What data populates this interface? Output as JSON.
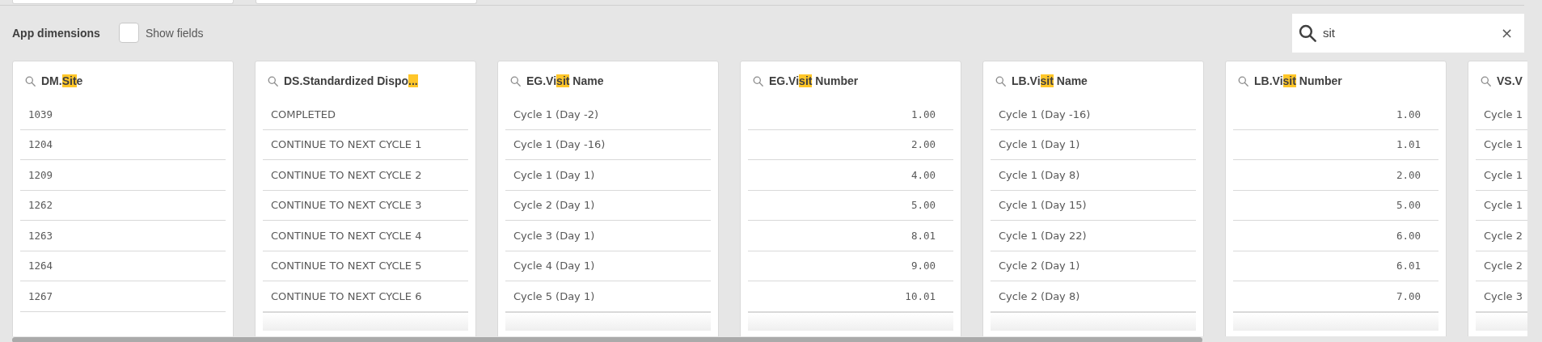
{
  "toolbar": {
    "title": "App dimensions",
    "show_fields": {
      "label": "Show fields",
      "checked": false
    },
    "search": {
      "value": "sit",
      "clear": "×"
    }
  },
  "columns": [
    {
      "title": {
        "before": "DM.",
        "match": "Sit",
        "after": "e"
      },
      "kind": "code",
      "rows": [
        "1039",
        "1204",
        "1209",
        "1262",
        "1263",
        "1264",
        "1267"
      ],
      "more": false
    },
    {
      "title": {
        "before": "DS.Standardized Dispo",
        "match": "..."
      },
      "kind": "text",
      "rows": [
        "COMPLETED",
        "CONTINUE TO NEXT CYCLE 1",
        "CONTINUE TO NEXT CYCLE 2",
        "CONTINUE TO NEXT CYCLE 3",
        "CONTINUE TO NEXT CYCLE 4",
        "CONTINUE TO NEXT CYCLE 5",
        "CONTINUE TO NEXT CYCLE 6"
      ],
      "more": true
    },
    {
      "title": {
        "before": "EG.Vi",
        "match": "sit",
        "after": " Name"
      },
      "kind": "text",
      "rows": [
        "Cycle 1 (Day -2)",
        "Cycle 1 (Day -16)",
        "Cycle 1 (Day 1)",
        "Cycle 2 (Day 1)",
        "Cycle 3 (Day 1)",
        "Cycle 4 (Day 1)",
        "Cycle 5 (Day 1)"
      ],
      "more": true
    },
    {
      "title": {
        "before": "EG.Vi",
        "match": "sit",
        "after": " Number"
      },
      "kind": "number",
      "rows": [
        "1.00",
        "2.00",
        "4.00",
        "5.00",
        "8.01",
        "9.00",
        "10.01"
      ],
      "more": true
    },
    {
      "title": {
        "before": "LB.Vi",
        "match": "sit",
        "after": " Name"
      },
      "kind": "text",
      "rows": [
        "Cycle 1 (Day -16)",
        "Cycle 1 (Day 1)",
        "Cycle 1 (Day 8)",
        "Cycle 1 (Day 15)",
        "Cycle 1 (Day 22)",
        "Cycle 2 (Day 1)",
        "Cycle 2 (Day 8)"
      ],
      "more": true
    },
    {
      "title": {
        "before": "LB.Vi",
        "match": "sit",
        "after": " Number"
      },
      "kind": "number",
      "rows": [
        "1.00",
        "1.01",
        "2.00",
        "5.00",
        "6.00",
        "6.01",
        "7.00"
      ],
      "more": true
    },
    {
      "title": {
        "before": "VS.V"
      },
      "kind": "text",
      "rows": [
        "Cycle 1",
        "Cycle 1",
        "Cycle 1",
        "Cycle 1",
        "Cycle 2",
        "Cycle 2",
        "Cycle 3"
      ],
      "more": true
    }
  ]
}
